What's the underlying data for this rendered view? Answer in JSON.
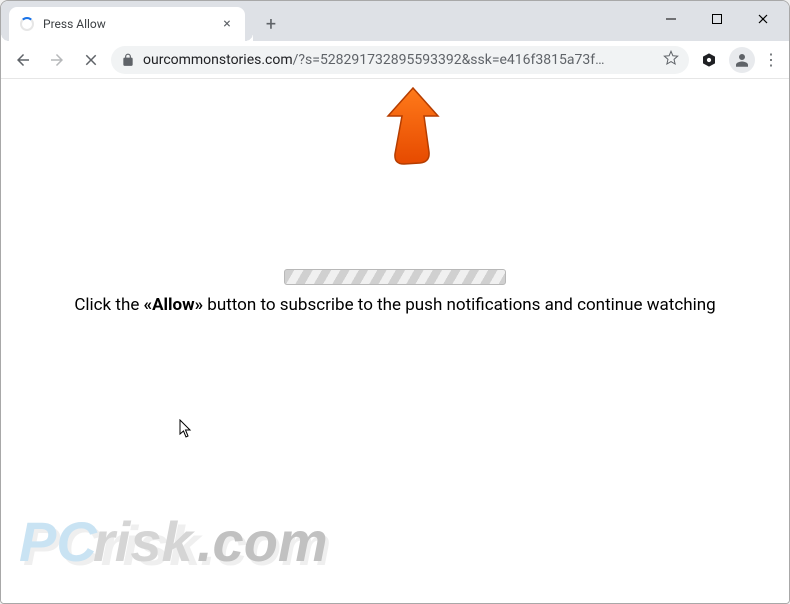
{
  "window": {
    "minimize": "–",
    "maximize": "▢",
    "close": "×"
  },
  "tab": {
    "title": "Press Allow",
    "close": "×"
  },
  "newtab": "+",
  "address": {
    "domain": "ourcommonstories.com",
    "rest": "/?s=528291732895593392&ssk=e416f3815a73f…"
  },
  "more_menu": "⋮",
  "page": {
    "prefix": "Click the ",
    "allow": "«Allow»",
    "suffix": " button to subscribe to the push notifications and continue watching"
  },
  "watermark": {
    "pc": "PC",
    "risk": "risk",
    "dotcom": ".com",
    "shadow": "PCrisk.com"
  }
}
